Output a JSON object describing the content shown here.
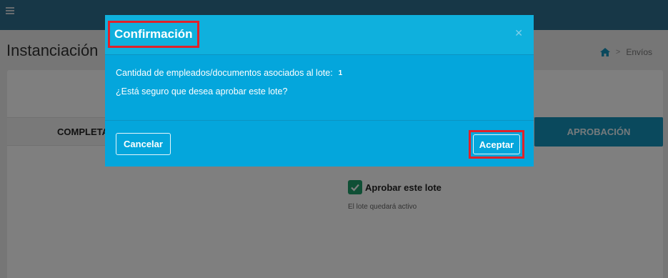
{
  "page": {
    "title": "Instanciación",
    "breadcrumb": {
      "home_icon": "home-icon",
      "current": "Envíos",
      "separator": ">"
    },
    "tabs": [
      {
        "label": "COMPLETAR"
      },
      {
        "label": "APROBACIÓN"
      }
    ],
    "approve": {
      "checkbox_checked": true,
      "label": "Aprobar este lote",
      "hint": "El lote quedará activo"
    },
    "colors": {
      "topbar": "#2f6f8f",
      "accent": "#1593ba",
      "check": "#1e9e6a"
    }
  },
  "modal": {
    "title": "Confirmación",
    "close_icon": "close-icon",
    "count_label": "Cantidad de empleados/documentos asociados al lote:",
    "count_value": "1",
    "question": "¿Está seguro que desea aprobar este lote?",
    "cancel_label": "Cancelar",
    "accept_label": "Aceptar",
    "colors": {
      "background": "#04a6dc",
      "highlight": "#e0222a"
    }
  }
}
